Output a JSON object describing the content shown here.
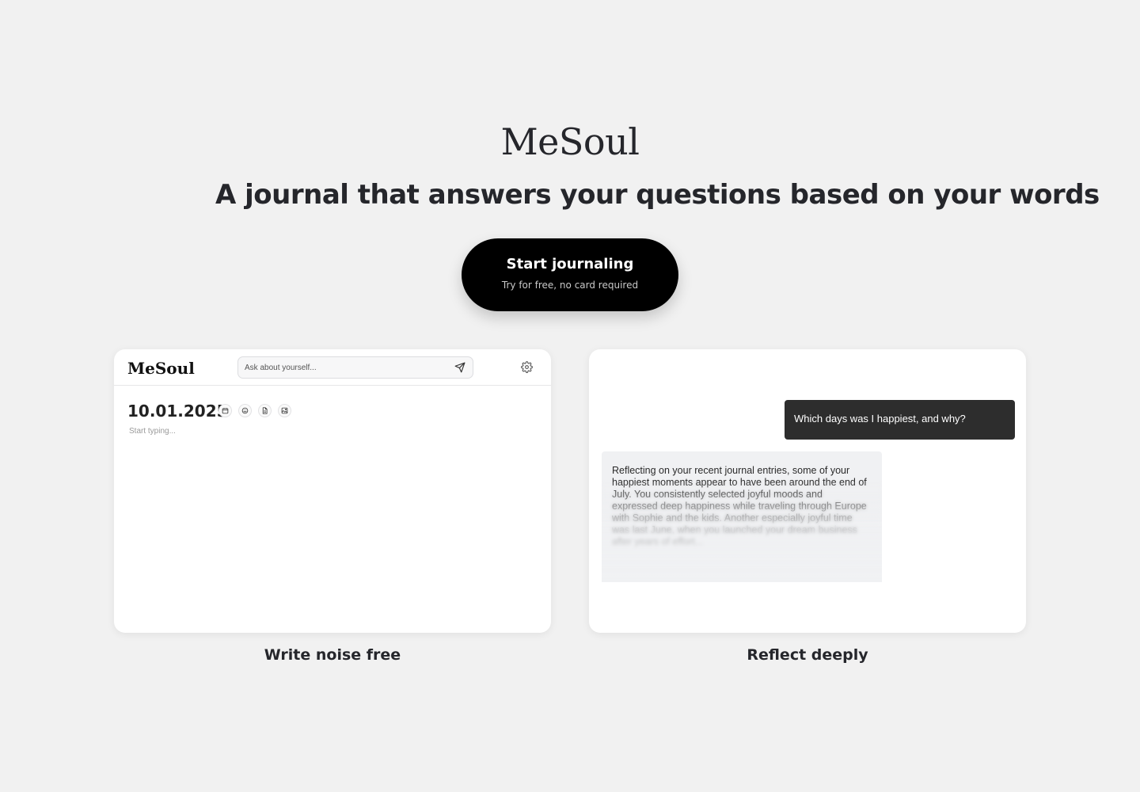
{
  "hero": {
    "brand": "MeSoul",
    "headline": "A journal that answers your questions based on your words",
    "cta_label": "Start journaling",
    "cta_sublabel": "Try for free, no card required"
  },
  "editor_preview": {
    "logo": "MeSoul",
    "ask_placeholder": "Ask about yourself...",
    "date": "10.01.2025",
    "body_placeholder": "Start typing...",
    "icons": [
      "send-icon",
      "gear-icon",
      "calendar-icon",
      "smiley-icon",
      "document-icon",
      "image-icon"
    ],
    "caption": "Write noise free"
  },
  "reflect_preview": {
    "question": "Which days was I happiest, and why?",
    "answer": "Reflecting on your recent journal entries, some of your happiest moments appear to have been around the end of July. You consistently selected joyful moods and expressed deep happiness while traveling through Europe with Sophie and the kids. Another especially joyful time was last June, when you launched your dream business after years of effort...",
    "caption": "Reflect deeply"
  },
  "colors": {
    "background": "#f1f1f1",
    "cta_background": "#000000",
    "question_bubble": "#2d2d2d",
    "answer_bubble": "#f0f1f3"
  }
}
